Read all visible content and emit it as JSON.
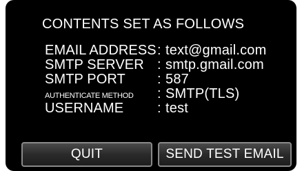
{
  "heading": "CONTENTS SET AS FOLLOWS",
  "separator": ":",
  "settings": [
    {
      "label": "EMAIL ADDRESS",
      "value": "text@gmail.com"
    },
    {
      "label": "SMTP SERVER",
      "value": "smtp.gmail.com"
    },
    {
      "label": "SMTP PORT",
      "value": "587"
    },
    {
      "label": "AUTHENTICATE METHOD",
      "value": "SMTP(TLS)"
    },
    {
      "label": "USERNAME",
      "value": "test"
    }
  ],
  "buttons": {
    "quit": "QUIT",
    "send_test": "SEND TEST EMAIL"
  },
  "colors": {
    "background": "#000000",
    "text": "#ffffff",
    "button_border": "#8a8a8a"
  }
}
